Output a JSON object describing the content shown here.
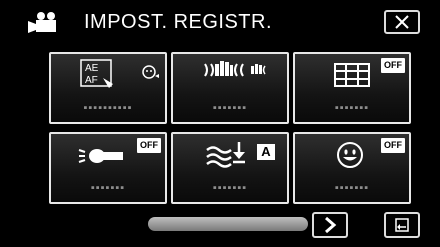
{
  "header": {
    "title": "IMPOST. REGISTR.",
    "mode_icon": "video-camera-icon",
    "close_icon": "close-icon"
  },
  "tiles": [
    {
      "icon": "ae-af-touch-icon",
      "label": "▪▪▪▪▪▪▪▪▪▪"
    },
    {
      "icon": "image-stabilizer-icon",
      "label": "▪▪▪▪▪▪▪"
    },
    {
      "icon": "grid-icon",
      "badge": "OFF",
      "label": "▪▪▪▪▪▪▪"
    },
    {
      "icon": "zoom-mic-icon",
      "badge": "OFF",
      "label": "▪▪▪▪▪▪▪"
    },
    {
      "icon": "wind-cut-icon",
      "badge": "A",
      "label": "▪▪▪▪▪▪▪"
    },
    {
      "icon": "smile-shot-icon",
      "badge": "OFF",
      "label": "▪▪▪▪▪▪▪"
    }
  ],
  "footer": {
    "scroll_position": 0.0,
    "next_icon": "chevron-right-icon",
    "return_icon": "return-icon"
  }
}
